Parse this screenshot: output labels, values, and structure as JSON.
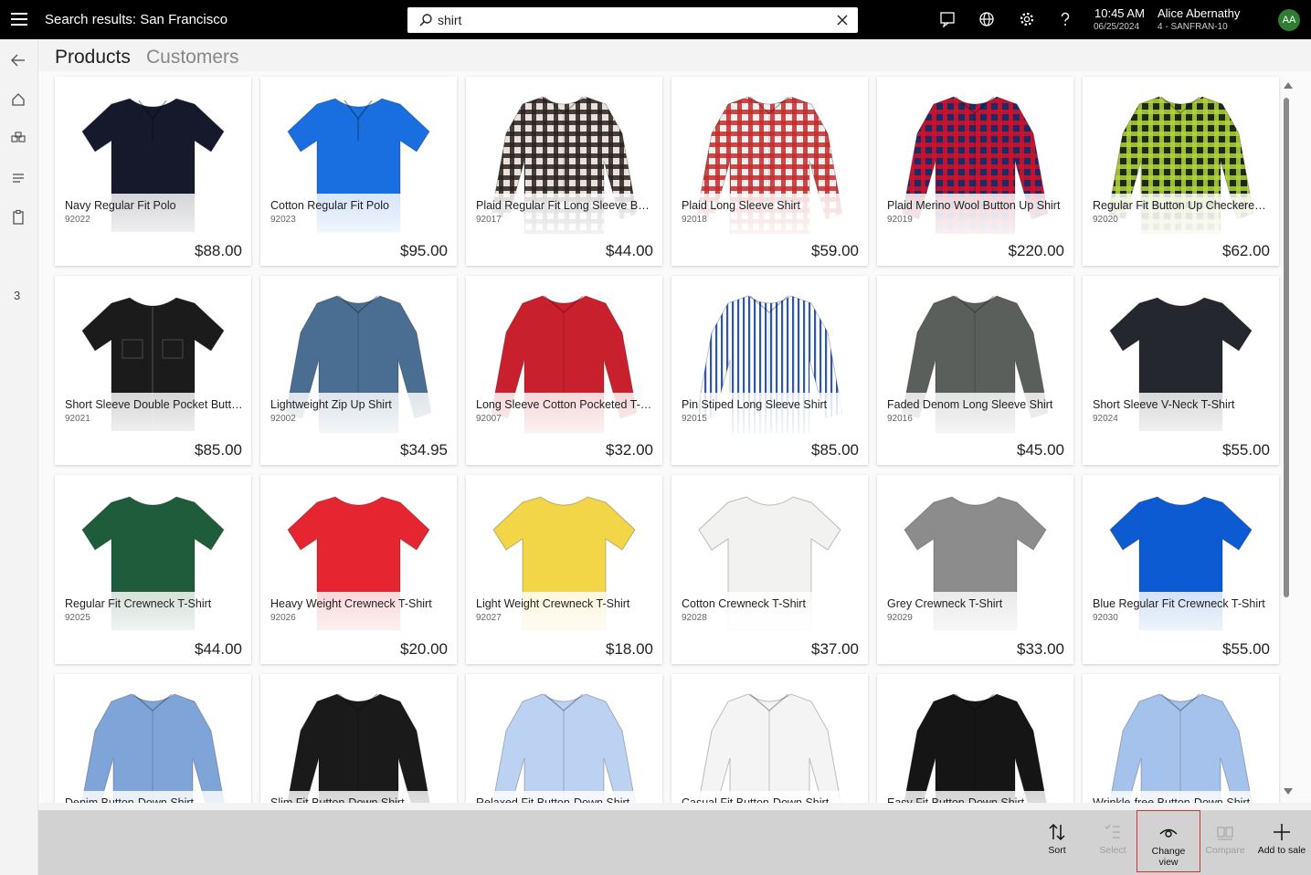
{
  "header": {
    "title": "Search results: San Francisco",
    "search_value": "shirt",
    "time": "10:45 AM",
    "date": "06/25/2024",
    "user_name": "Alice Abernathy",
    "store": "4 - SANFRAN-10",
    "avatar_initials": "AA",
    "avatar_color": "#2e7d32"
  },
  "left_nav": {
    "cart_count": "3"
  },
  "tabs": {
    "products": "Products",
    "customers": "Customers"
  },
  "products": [
    {
      "name": "Navy Regular Fit Polo",
      "number": "92022",
      "price": "$88.00",
      "style": "polo",
      "color": "#15192b"
    },
    {
      "name": "Cotton Regular Fit Polo",
      "number": "92023",
      "price": "$95.00",
      "style": "polo",
      "color": "#1a6fe0"
    },
    {
      "name": "Plaid Regular Fit Long Sleeve Butt...",
      "number": "92017",
      "price": "$44.00",
      "style": "longplaid",
      "color": "#2a2120",
      "color2": "#e8e2dc"
    },
    {
      "name": "Plaid Long Sleeve Shirt",
      "number": "92018",
      "price": "$59.00",
      "style": "longplaid",
      "color": "#c42a2c",
      "color2": "#f1eeee"
    },
    {
      "name": "Plaid Merino Wool Button Up Shirt",
      "number": "92019",
      "price": "$220.00",
      "style": "longplaid",
      "color": "#d4122a",
      "color2": "#1c2a66"
    },
    {
      "name": "Regular Fit Button Up Checkered ...",
      "number": "92020",
      "price": "$62.00",
      "style": "longplaid",
      "color": "#b4d43c",
      "color2": "#1c2a10"
    },
    {
      "name": "Short Sleeve Double Pocket Butto...",
      "number": "92021",
      "price": "$85.00",
      "style": "shortbutton",
      "color": "#1b1b1b"
    },
    {
      "name": "Lightweight Zip Up Shirt",
      "number": "92002",
      "price": "$34.95",
      "style": "long",
      "color": "#4a6d92"
    },
    {
      "name": "Long Sleeve Cotton Pocketed T-S...",
      "number": "92007",
      "price": "$32.00",
      "style": "long",
      "color": "#c9202d"
    },
    {
      "name": "Pin Stiped Long Sleeve Shirt",
      "number": "92015",
      "price": "$85.00",
      "style": "longstripe",
      "color": "#2b57b8",
      "color2": "#ffffff"
    },
    {
      "name": "Faded Denom Long Sleeve Shirt",
      "number": "92016",
      "price": "$45.00",
      "style": "long",
      "color": "#5b5f5b"
    },
    {
      "name": "Short Sleeve V-Neck T-Shirt",
      "number": "92024",
      "price": "$55.00",
      "style": "tee",
      "color": "#24272d"
    },
    {
      "name": "Regular Fit Crewneck T-Shirt",
      "number": "92025",
      "price": "$44.00",
      "style": "tee",
      "color": "#1e5c3c"
    },
    {
      "name": "Heavy Weight Crewneck T-Shirt",
      "number": "92026",
      "price": "$20.00",
      "style": "tee",
      "color": "#e52630"
    },
    {
      "name": "Light Weight Crewneck T-Shirt",
      "number": "92027",
      "price": "$18.00",
      "style": "tee",
      "color": "#f3d548"
    },
    {
      "name": "Cotton Crewneck T-Shirt",
      "number": "92028",
      "price": "$37.00",
      "style": "tee",
      "color": "#f2f2f0"
    },
    {
      "name": "Grey Crewneck T-Shirt",
      "number": "92029",
      "price": "$33.00",
      "style": "tee",
      "color": "#8c8c8c"
    },
    {
      "name": "Blue Regular Fit Crewneck T-Shirt",
      "number": "92030",
      "price": "$55.00",
      "style": "tee",
      "color": "#0c5bd3"
    },
    {
      "name": "Denim Button-Down Shirt",
      "number": "",
      "price": "",
      "style": "long",
      "color": "#7fa5d8"
    },
    {
      "name": "Slim Fit Button-Down Shirt",
      "number": "",
      "price": "",
      "style": "long",
      "color": "#1a1a1a"
    },
    {
      "name": "Relaxed Fit Button-Down Shirt",
      "number": "",
      "price": "",
      "style": "long",
      "color": "#bcd2f2"
    },
    {
      "name": "Casual Fit Button-Down Shirt",
      "number": "",
      "price": "",
      "style": "long",
      "color": "#f4f4f4"
    },
    {
      "name": "Easy Fit Button-Down Shirt",
      "number": "",
      "price": "",
      "style": "long",
      "color": "#151515"
    },
    {
      "name": "Wrinkle-free Button-Down Shirt",
      "number": "",
      "price": "",
      "style": "long",
      "color": "#a5c2ec"
    }
  ],
  "actions": {
    "sort": "Sort",
    "select": "Select",
    "change_view_1": "Change",
    "change_view_2": "view",
    "compare": "Compare",
    "add_to_sale": "Add to sale"
  }
}
